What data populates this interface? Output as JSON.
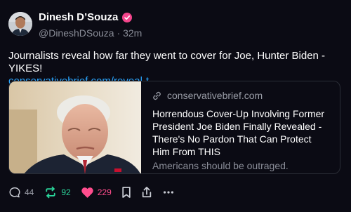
{
  "author": {
    "name": "Dinesh D’Souza",
    "verified_color": "#f5458c",
    "handle": "@DineshDSouza",
    "time": "32m",
    "avatar_icon": "person-photo"
  },
  "post": {
    "text": "Journalists reveal how far they went to cover for Joe, Hunter Biden - YIKES!",
    "link": "conservativebrief.com/reveal-t..."
  },
  "card": {
    "domain": "conservativebrief.com",
    "title": "Horrendous Cover-Up Involving Former President Joe Biden Finally Revealed - There's No Pardon That Can Protect Him From THIS",
    "description": "Americans should be outraged.",
    "image_icon": "news-photo"
  },
  "actions": {
    "reply_count": "44",
    "repost_count": "92",
    "like_count": "229",
    "repost_color": "#2bd69b",
    "like_color": "#ff4d8d",
    "icons": [
      "reply-icon",
      "repost-icon",
      "heart-icon",
      "bookmark-icon",
      "share-icon",
      "more-icon"
    ]
  }
}
